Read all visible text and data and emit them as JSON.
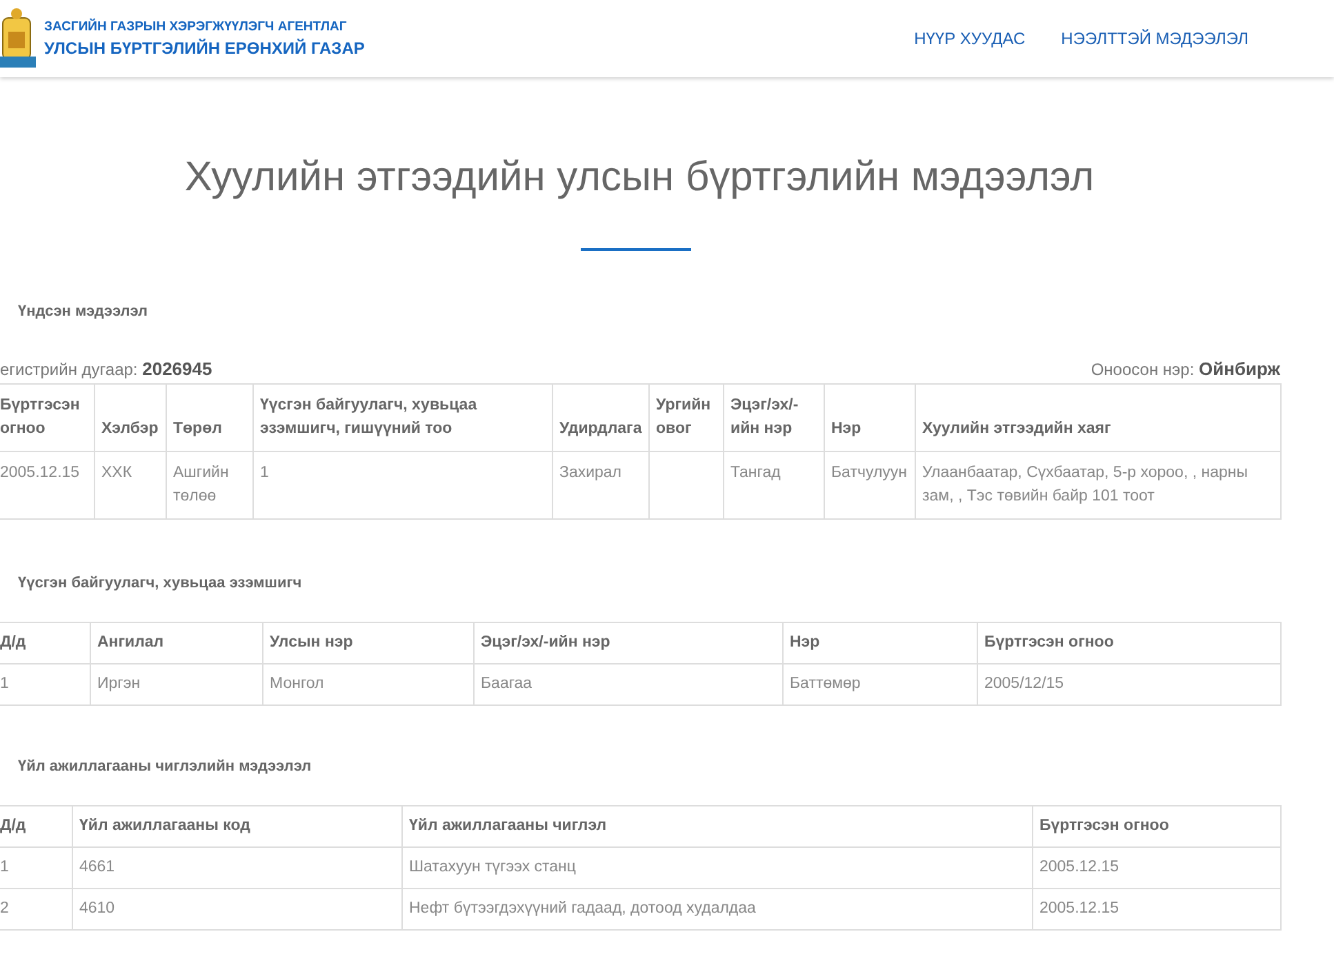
{
  "header": {
    "agency": "ЗАСГИЙН ГАЗРЫН ХЭРЭГЖҮҮЛЭГЧ АГЕНТЛАГ",
    "org": "УЛСЫН БҮРТГЭЛИЙН ЕРӨНХИЙ ГАЗАР",
    "nav": [
      "НҮҮР ХУУДАС",
      "НЭЭЛТТЭЙ МЭДЭЭЛЭЛ"
    ]
  },
  "title": "Хуулийн этгээдийн улсын бүртгэлийн мэдээлэл",
  "sections": [
    {
      "heading": "Үндсэн мэдээлэл",
      "register_label": "егистрийн дугаар:",
      "register_value": "2026945",
      "name_label": "Оноосон нэр:",
      "name_value": "Ойнбирж",
      "columns": [
        "Бүртгэсэн огноо",
        "Хэлбэр",
        "Төрөл",
        "Үүсгэн байгуулагч, хувьцаа эзэмшигч, гишүүний тоо",
        "Удирдлага",
        "Ургийн овог",
        "Эцэг/эх/-ийн нэр",
        "Нэр",
        "Хуулийн этгээдийн хаяг"
      ],
      "rows": [
        [
          "2005.12.15",
          "ХХК",
          "Ашгийн төлөө",
          "1",
          "Захирал",
          "",
          "Тангад",
          "Батчулуун",
          "Улаанбаатар, Сүхбаатар, 5-р хороо, , нарны зам, , Тэс төвийн байр 101 тоот"
        ]
      ]
    },
    {
      "heading": "Үүсгэн байгуулагч, хувьцаа эзэмшигч",
      "columns": [
        "Д/д",
        "Ангилал",
        "Улсын нэр",
        "Эцэг/эх/-ийн нэр",
        "Нэр",
        "Бүртгэсэн огноо"
      ],
      "rows": [
        [
          "1",
          "Иргэн",
          "Монгол",
          "Баагаа",
          "Баттөмөр",
          "2005/12/15"
        ]
      ]
    },
    {
      "heading": "Үйл ажиллагааны чиглэлийн мэдээлэл",
      "columns": [
        "Д/д",
        "Үйл ажиллагааны код",
        "Үйл ажиллагааны чиглэл",
        "Бүртгэсэн огноо"
      ],
      "rows": [
        [
          "1",
          "4661",
          "Шатахуун түгээх станц",
          "2005.12.15"
        ],
        [
          "2",
          "4610",
          "Нефт бүтээгдэхүүний гадаад, дотоод худалдаа",
          "2005.12.15"
        ]
      ]
    }
  ]
}
